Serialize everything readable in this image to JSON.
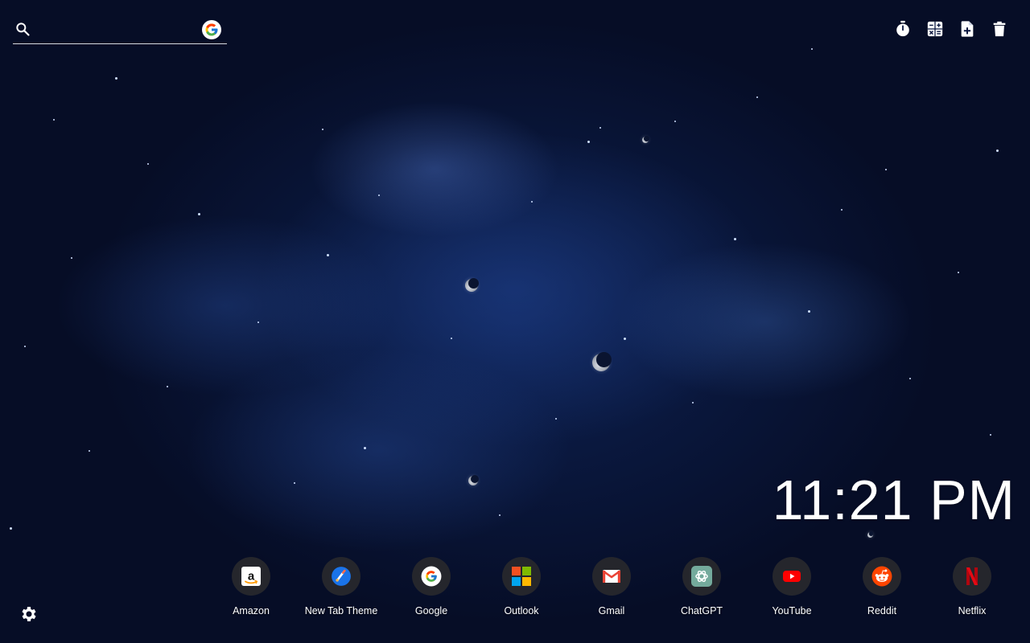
{
  "search": {
    "placeholder": "",
    "value": "",
    "engine_icon": "google-g-icon"
  },
  "toolbar": {
    "items": [
      {
        "name": "timer",
        "icon": "stopwatch-icon"
      },
      {
        "name": "calculator",
        "icon": "calculator-icon"
      },
      {
        "name": "new-note",
        "icon": "note-add-icon"
      },
      {
        "name": "delete",
        "icon": "trash-icon"
      }
    ]
  },
  "clock": {
    "time": "11:21 PM"
  },
  "shortcuts": [
    {
      "label": "Amazon",
      "icon": "amazon-icon"
    },
    {
      "label": "New Tab Theme",
      "icon": "new-tab-theme-icon"
    },
    {
      "label": "Google",
      "icon": "google-icon"
    },
    {
      "label": "Outlook",
      "icon": "microsoft-icon"
    },
    {
      "label": "Gmail",
      "icon": "gmail-icon"
    },
    {
      "label": "ChatGPT",
      "icon": "chatgpt-icon"
    },
    {
      "label": "YouTube",
      "icon": "youtube-icon"
    },
    {
      "label": "Reddit",
      "icon": "reddit-icon"
    },
    {
      "label": "Netflix",
      "icon": "netflix-icon"
    }
  ],
  "settings": {
    "icon": "gear-icon"
  },
  "colors": {
    "background": "#060d26",
    "nebula": "#2a5bbf",
    "text": "#ffffff",
    "tile": "#28282c"
  }
}
